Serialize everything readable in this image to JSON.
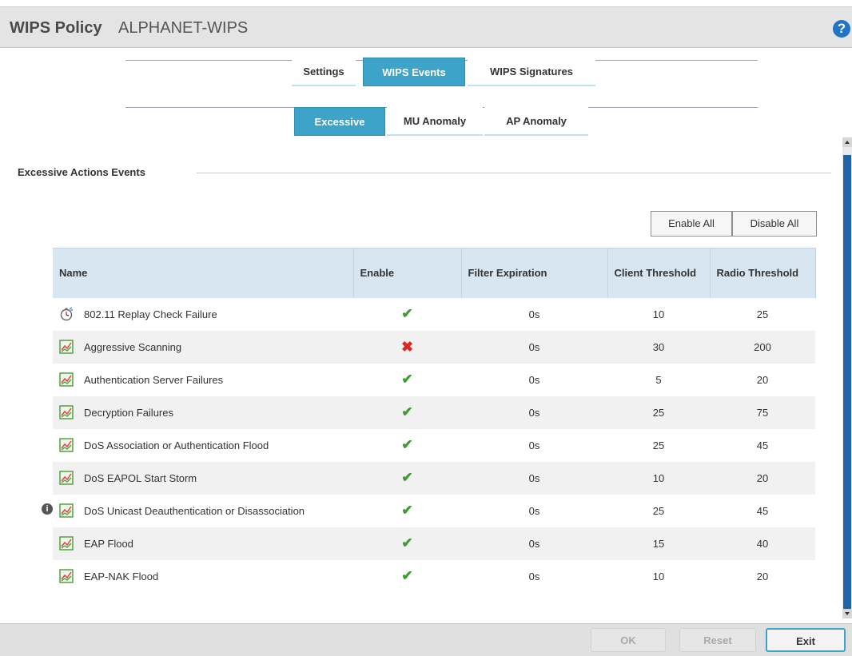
{
  "header": {
    "title": "WIPS Policy",
    "policy_name": "ALPHANET-WIPS",
    "help_icon": "help-icon",
    "help_symbol": "?"
  },
  "tabs": [
    {
      "label": "Settings",
      "active": false
    },
    {
      "label": "WIPS Events",
      "active": true
    },
    {
      "label": "WIPS Signatures",
      "active": false
    }
  ],
  "subtabs": [
    {
      "label": "Excessive",
      "active": true
    },
    {
      "label": "MU Anomaly",
      "active": false
    },
    {
      "label": "AP Anomaly",
      "active": false
    }
  ],
  "section": {
    "title": "Excessive Actions Events"
  },
  "actions": {
    "enable_all": "Enable All",
    "disable_all": "Disable All"
  },
  "table": {
    "headers": [
      "Name",
      "Enable",
      "Filter Expiration",
      "Client Threshold",
      "Radio Threshold"
    ],
    "rows": [
      {
        "icon": "stopwatch-icon",
        "name": "802.11 Replay Check Failure",
        "enabled": true,
        "filter_expiration": "0s",
        "client_threshold": "10",
        "radio_threshold": "25"
      },
      {
        "icon": "chart-icon",
        "name": "Aggressive Scanning",
        "enabled": false,
        "filter_expiration": "0s",
        "client_threshold": "30",
        "radio_threshold": "200"
      },
      {
        "icon": "chart-icon",
        "name": "Authentication Server Failures",
        "enabled": true,
        "filter_expiration": "0s",
        "client_threshold": "5",
        "radio_threshold": "20"
      },
      {
        "icon": "chart-icon",
        "name": "Decryption Failures",
        "enabled": true,
        "filter_expiration": "0s",
        "client_threshold": "25",
        "radio_threshold": "75"
      },
      {
        "icon": "chart-icon",
        "name": "DoS Association or Authentication Flood",
        "enabled": true,
        "filter_expiration": "0s",
        "client_threshold": "25",
        "radio_threshold": "45"
      },
      {
        "icon": "chart-icon",
        "name": "DoS EAPOL Start Storm",
        "enabled": true,
        "filter_expiration": "0s",
        "client_threshold": "10",
        "radio_threshold": "20"
      },
      {
        "icon": "chart-icon",
        "name": "DoS Unicast Deauthentication or Disassociation",
        "enabled": true,
        "filter_expiration": "0s",
        "client_threshold": "25",
        "radio_threshold": "45"
      },
      {
        "icon": "chart-icon",
        "name": "EAP Flood",
        "enabled": true,
        "filter_expiration": "0s",
        "client_threshold": "15",
        "radio_threshold": "40"
      },
      {
        "icon": "chart-icon",
        "name": "EAP-NAK Flood",
        "enabled": true,
        "filter_expiration": "0s",
        "client_threshold": "10",
        "radio_threshold": "20"
      }
    ]
  },
  "footer": {
    "ok": "OK",
    "reset": "Reset",
    "exit": "Exit"
  },
  "colors": {
    "accent": "#3ea3c8",
    "check": "#3d9b2f",
    "cross": "#e0251f",
    "scroll_thumb": "#1f63a8"
  }
}
